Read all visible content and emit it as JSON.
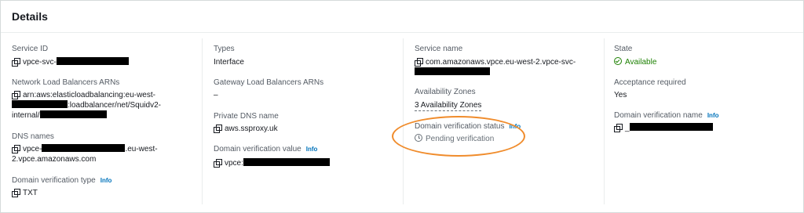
{
  "panel": {
    "title": "Details"
  },
  "c1": {
    "service_id_label": "Service ID",
    "service_id_prefix": "vpce-svc-",
    "nlb_label": "Network Load Balancers ARNs",
    "nlb_line1": "arn:aws:elasticloadbalancing:eu-west-",
    "nlb_line2_suffix": ":loadbalancer/net/Squidv2-",
    "nlb_line3_prefix": "internal/",
    "dns_label": "DNS names",
    "dns_prefix": "vpce-",
    "dns_mid": ".eu-west-",
    "dns_line2": "2.vpce.amazonaws.com",
    "dvt_label": "Domain verification type",
    "dvt_info": "Info",
    "dvt_value": "TXT"
  },
  "c2": {
    "types_label": "Types",
    "types_value": "Interface",
    "gwlb_label": "Gateway Load Balancers ARNs",
    "gwlb_value": "–",
    "pdns_label": "Private DNS name",
    "pdns_value": "aws.ssproxy.uk",
    "dvv_label": "Domain verification value",
    "dvv_info": "Info",
    "dvv_prefix": "vpce:"
  },
  "c3": {
    "sname_label": "Service name",
    "sname_value": "com.amazonaws.vpce.eu-west-2.vpce-svc-",
    "az_label": "Availability Zones",
    "az_value": "3 Availability Zones",
    "dvs_label": "Domain verification status",
    "dvs_info": "Info",
    "dvs_value": "Pending verification"
  },
  "c4": {
    "state_label": "State",
    "state_value": "Available",
    "accept_label": "Acceptance required",
    "accept_value": "Yes",
    "dvn_label": "Domain verification name",
    "dvn_info": "Info",
    "dvn_prefix": "_"
  },
  "colors": {
    "available": "#1d8102",
    "info": "#0073bb",
    "highlight": "#f08c2c"
  }
}
